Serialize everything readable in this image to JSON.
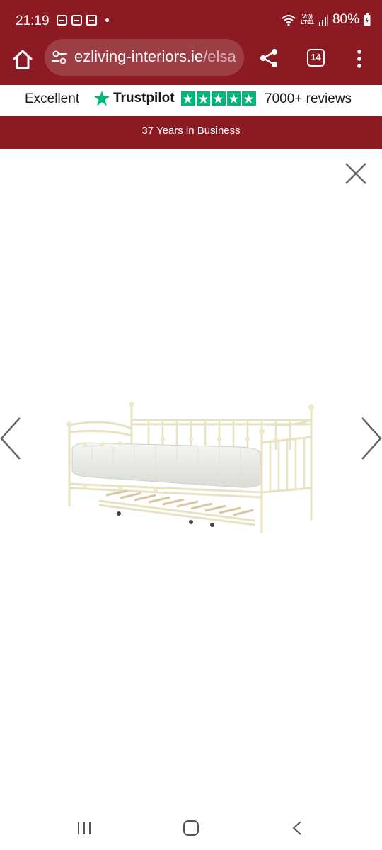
{
  "status_bar": {
    "time": "21:19",
    "battery": "80%",
    "network_top": "Vo))",
    "network_bottom": "LTE1"
  },
  "browser": {
    "url_domain": "ezliving-interiors.ie",
    "url_path": "/elsa",
    "tab_count": "14"
  },
  "trustpilot": {
    "rating_word": "Excellent",
    "brand": "Trustpilot",
    "stars": 5,
    "reviews": "7000+ reviews",
    "star_color": "#00b67a"
  },
  "banner": {
    "text": "37 Years in Business",
    "color": "#8b1a22"
  },
  "lightbox": {
    "image_subject": "cream-metal-day-bed-with-trundle",
    "close_icon": "close-icon",
    "prev_icon": "chevron-left-icon",
    "next_icon": "chevron-right-icon"
  },
  "nav": {
    "recents_icon": "recents-icon",
    "home_icon": "home-icon",
    "back_icon": "back-icon"
  }
}
